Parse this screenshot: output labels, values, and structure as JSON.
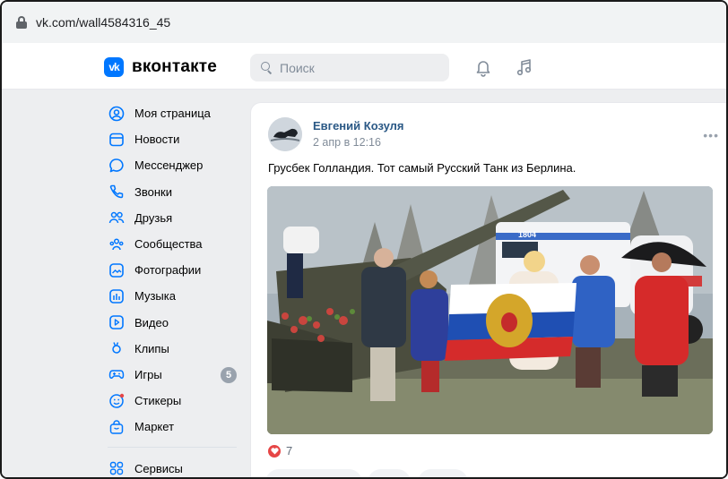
{
  "browser": {
    "url": "vk.com/wall4584316_45"
  },
  "header": {
    "logo_mark": "vk",
    "logo_text": "вконтакте",
    "search_placeholder": "Поиск",
    "icons": [
      "bell-icon",
      "music-icon"
    ]
  },
  "sidebar": {
    "items": [
      {
        "label": "Моя страница",
        "icon": "user-circle-icon"
      },
      {
        "label": "Новости",
        "icon": "news-icon"
      },
      {
        "label": "Мессенджер",
        "icon": "message-icon"
      },
      {
        "label": "Звонки",
        "icon": "phone-icon"
      },
      {
        "label": "Друзья",
        "icon": "friends-icon"
      },
      {
        "label": "Сообщества",
        "icon": "communities-icon"
      },
      {
        "label": "Фотографии",
        "icon": "photo-icon"
      },
      {
        "label": "Музыка",
        "icon": "music-icon"
      },
      {
        "label": "Видео",
        "icon": "video-icon"
      },
      {
        "label": "Клипы",
        "icon": "clips-icon"
      },
      {
        "label": "Игры",
        "icon": "games-icon",
        "badge": "5"
      },
      {
        "label": "Стикеры",
        "icon": "stickers-icon"
      },
      {
        "label": "Маркет",
        "icon": "market-icon"
      },
      {
        "label": "Сервисы",
        "icon": "services-icon"
      }
    ]
  },
  "post": {
    "author": "Евгений Козуля",
    "date": "2 апр в 12:16",
    "text": "Грусбек Голландия. Тот самый Русский Танк из Берлина.",
    "more": "•••",
    "likes": "7",
    "photo_alt": "Photo with people holding a Russian flag in front of a tank and an ambulance",
    "ambulance_number": "1804"
  },
  "colors": {
    "accent": "#0077ff",
    "link": "#2a5885",
    "like": "#e64646",
    "background": "#edeef0"
  }
}
